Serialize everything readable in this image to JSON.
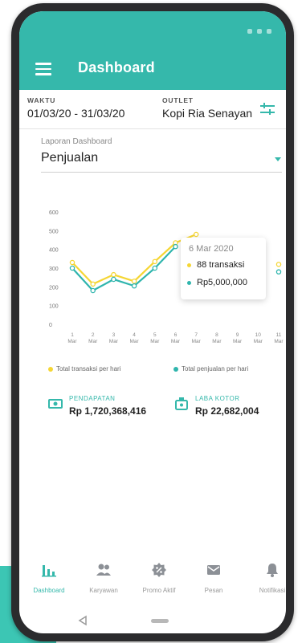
{
  "header": {
    "title": "Dashboard"
  },
  "filters": {
    "date_label": "WAKTU",
    "date_value": "01/03/20 - 31/03/20",
    "outlet_label": "OUTLET",
    "outlet_value": "Kopi Ria Senayan"
  },
  "report_select": {
    "label": "Laporan Dashboard",
    "value": "Penjualan"
  },
  "chart_data": {
    "type": "line",
    "y_ticks": [
      "0",
      "100",
      "200",
      "300",
      "400",
      "500",
      "600"
    ],
    "ylim": [
      0,
      600
    ],
    "x_ticks": [
      {
        "day": "1",
        "month": "Mar"
      },
      {
        "day": "2",
        "month": "Mar"
      },
      {
        "day": "3",
        "month": "Mar"
      },
      {
        "day": "4",
        "month": "Mar"
      },
      {
        "day": "5",
        "month": "Mar"
      },
      {
        "day": "6",
        "month": "Mar"
      },
      {
        "day": "7",
        "month": "Mar"
      },
      {
        "day": "8",
        "month": "Mar"
      },
      {
        "day": "9",
        "month": "Mar"
      },
      {
        "day": "10",
        "month": "Mar"
      },
      {
        "day": "11",
        "month": "Mar"
      }
    ],
    "series": [
      {
        "name": "Total transaksi per hari",
        "color": "#f5d634",
        "values": [
          330,
          215,
          265,
          230,
          335,
          435,
          480,
          null,
          null,
          null,
          320
        ]
      },
      {
        "name": "Total penjualan per hari",
        "color": "#2fb5ad",
        "values": [
          300,
          180,
          240,
          205,
          300,
          415,
          null,
          null,
          null,
          null,
          280
        ]
      }
    ],
    "tooltip": {
      "date": "6 Mar 2020",
      "transactions": "88 transaksi",
      "sales": "Rp5,000,000"
    },
    "grid": false
  },
  "summary": {
    "revenue_label": "PENDAPATAN",
    "revenue_value": "Rp 1,720,368,416",
    "profit_label": "LABA KOTOR",
    "profit_value": "Rp 22,682,004"
  },
  "nav": {
    "items": [
      {
        "label": "Dashboard",
        "icon": "bar-chart-icon"
      },
      {
        "label": "Karyawan",
        "icon": "people-icon"
      },
      {
        "label": "Promo Aktif",
        "icon": "promo-badge-icon"
      },
      {
        "label": "Pesan",
        "icon": "mail-icon"
      },
      {
        "label": "Notifikasi",
        "icon": "bell-icon"
      }
    ]
  },
  "colors": {
    "accent": "#35b8ab",
    "series_yellow": "#f5d634",
    "series_teal": "#2fb5ad"
  }
}
